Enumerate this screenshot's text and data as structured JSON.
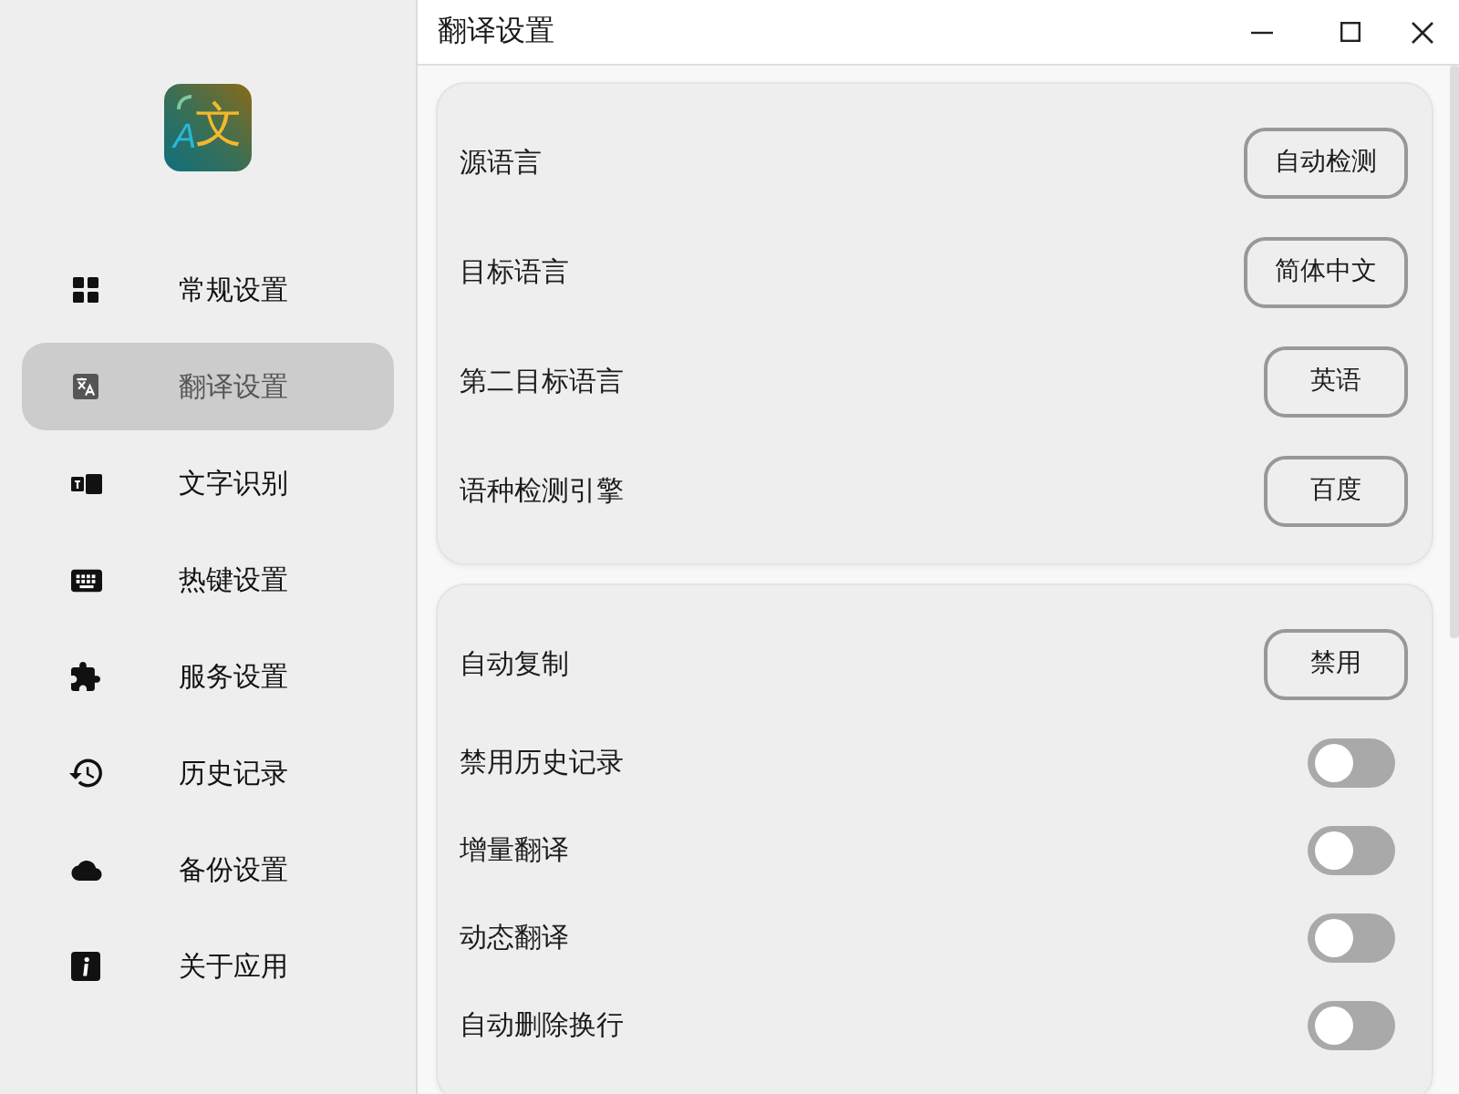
{
  "window": {
    "title": "翻译设置"
  },
  "logo": {
    "latin": "A",
    "cjk": "文"
  },
  "sidebar": {
    "items": [
      {
        "kind": "grid",
        "label": "常规设置",
        "selected": false
      },
      {
        "kind": "translate",
        "label": "翻译设置",
        "selected": true
      },
      {
        "kind": "ocr",
        "label": "文字识别",
        "selected": false
      },
      {
        "kind": "keyboard",
        "label": "热键设置",
        "selected": false
      },
      {
        "kind": "puzzle",
        "label": "服务设置",
        "selected": false
      },
      {
        "kind": "history",
        "label": "历史记录",
        "selected": false
      },
      {
        "kind": "cloud",
        "label": "备份设置",
        "selected": false
      },
      {
        "kind": "info",
        "label": "关于应用",
        "selected": false
      }
    ]
  },
  "sections": [
    {
      "rows": [
        {
          "kind": "select",
          "label": "源语言",
          "value": "自动检测"
        },
        {
          "kind": "select",
          "label": "目标语言",
          "value": "简体中文"
        },
        {
          "kind": "select",
          "label": "第二目标语言",
          "value": "英语"
        },
        {
          "kind": "select",
          "label": "语种检测引擎",
          "value": "百度"
        }
      ]
    },
    {
      "rows": [
        {
          "kind": "select",
          "label": "自动复制",
          "value": "禁用"
        },
        {
          "kind": "toggle",
          "label": "禁用历史记录",
          "checked": false
        },
        {
          "kind": "toggle",
          "label": "增量翻译",
          "checked": false
        },
        {
          "kind": "toggle",
          "label": "动态翻译",
          "checked": false
        },
        {
          "kind": "toggle",
          "label": "自动删除换行",
          "checked": false
        }
      ]
    }
  ]
}
